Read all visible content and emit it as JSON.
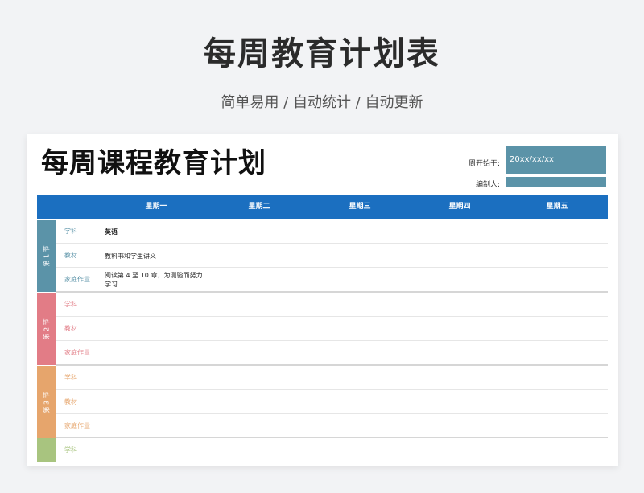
{
  "hero": {
    "title": "每周教育计划表",
    "subtitle": "简单易用 / 自动统计 / 自动更新"
  },
  "doc": {
    "title": "每周课程教育计划"
  },
  "meta": {
    "week_start_label": "周开始于:",
    "week_start_value": "20xx/xx/xx",
    "author_label": "编制人:",
    "author_value": ""
  },
  "days": [
    "星期一",
    "星期二",
    "星期三",
    "星期四",
    "星期五"
  ],
  "colors": {
    "header": "#1b6fc0",
    "sec1": "#5b93a8",
    "sec2": "#e27c86",
    "sec3": "#e6a56c",
    "sec4": "#a8c47f"
  },
  "sections": [
    {
      "tag": "第 1 节",
      "rows": [
        {
          "label": "学科",
          "value": "英语"
        },
        {
          "label": "教材",
          "value": "教科书和学生讲义"
        },
        {
          "label": "家庭作业",
          "value": "阅读第 4 至 10 章，为测验而努力\n学习"
        }
      ]
    },
    {
      "tag": "第 2 节",
      "rows": [
        {
          "label": "学科",
          "value": ""
        },
        {
          "label": "教材",
          "value": ""
        },
        {
          "label": "家庭作业",
          "value": ""
        }
      ]
    },
    {
      "tag": "第 3 节",
      "rows": [
        {
          "label": "学科",
          "value": ""
        },
        {
          "label": "教材",
          "value": ""
        },
        {
          "label": "家庭作业",
          "value": ""
        }
      ]
    },
    {
      "tag": "",
      "rows": [
        {
          "label": "学科",
          "value": ""
        }
      ]
    }
  ]
}
